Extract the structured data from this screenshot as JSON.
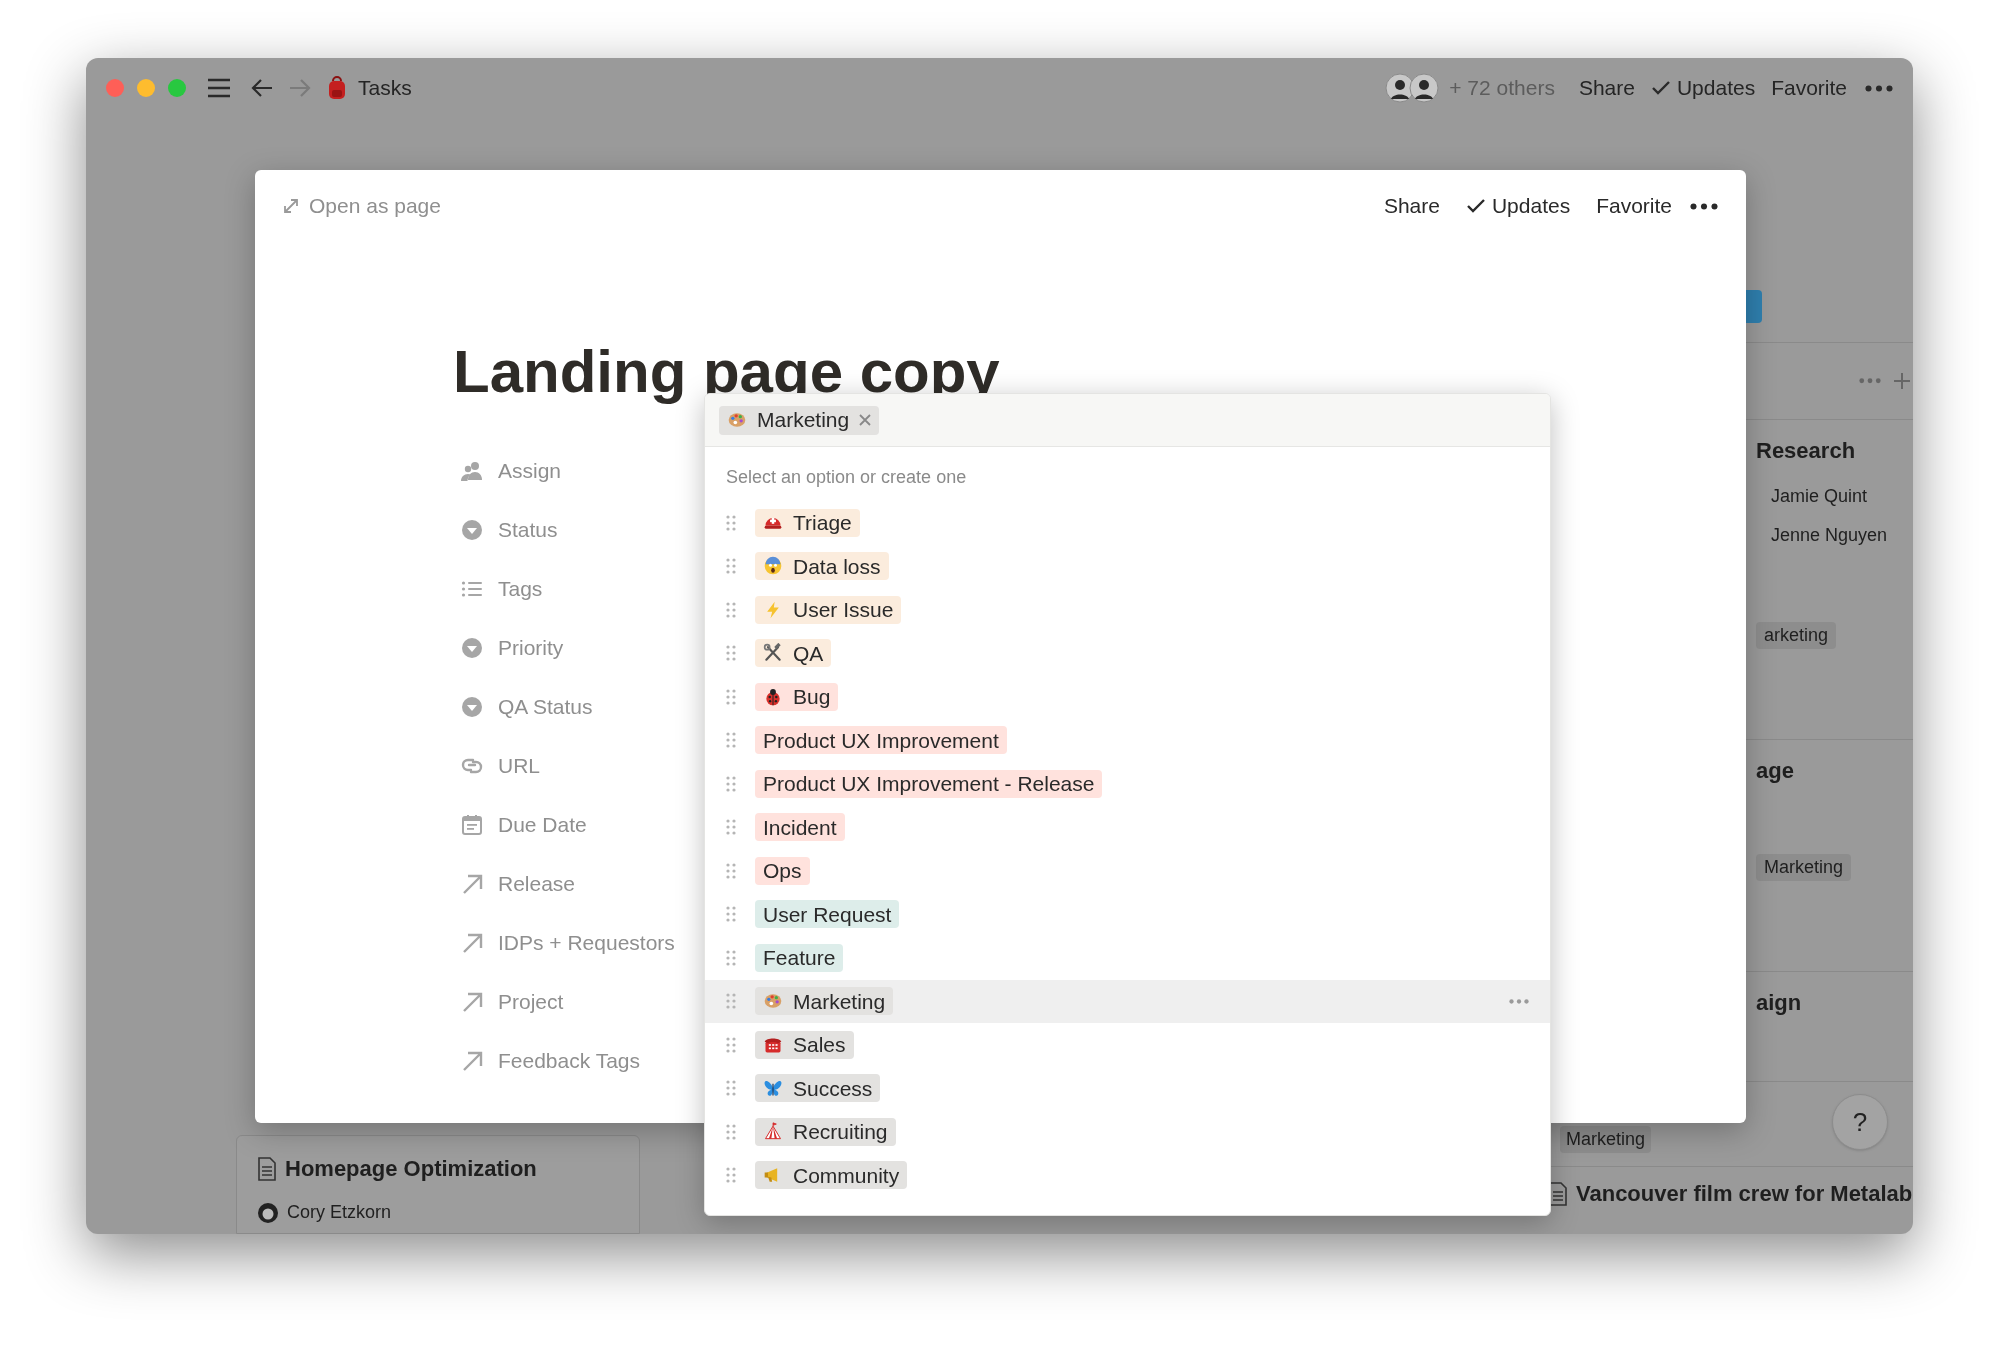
{
  "window": {
    "title": "Tasks",
    "nav": [
      {
        "kind": "back",
        "disabled": false
      },
      {
        "kind": "forward",
        "disabled": true
      }
    ],
    "collaborators": "+ 72 others",
    "actions": [
      {
        "label": "Share",
        "kind": "plain"
      },
      {
        "label": "Updates",
        "kind": "toggle"
      },
      {
        "label": "Favorite",
        "kind": "plain"
      }
    ]
  },
  "modal": {
    "open_as_page": "Open as page",
    "actions": [
      {
        "label": "Share",
        "kind": "plain"
      },
      {
        "label": "Updates",
        "kind": "toggle"
      },
      {
        "label": "Favorite",
        "kind": "plain"
      }
    ],
    "title": "Landing page copy",
    "properties": [
      {
        "kind": "people",
        "label": "Assign"
      },
      {
        "kind": "select",
        "label": "Status"
      },
      {
        "kind": "list",
        "label": "Tags"
      },
      {
        "kind": "select",
        "label": "Priority"
      },
      {
        "kind": "select",
        "label": "QA Status"
      },
      {
        "kind": "link",
        "label": "URL"
      },
      {
        "kind": "calendar",
        "label": "Due Date"
      },
      {
        "kind": "relation",
        "label": "Release"
      },
      {
        "kind": "relation",
        "label": "IDPs + Requestors"
      },
      {
        "kind": "relation",
        "label": "Project"
      },
      {
        "kind": "relation",
        "label": "Feedback Tags"
      }
    ]
  },
  "select_menu": {
    "selected_tags": [
      {
        "label": "Marketing",
        "kind": "palette",
        "color": "#e3e2e0"
      }
    ],
    "hint": "Select an option or create one",
    "options": [
      {
        "label": "Triage",
        "kind": "helmet",
        "color": "#fbecdd",
        "highlighted": false
      },
      {
        "label": "Data loss",
        "kind": "scream",
        "color": "#fbecdd",
        "highlighted": false
      },
      {
        "label": "User Issue",
        "kind": "bolt",
        "color": "#fbecdd",
        "highlighted": false
      },
      {
        "label": "QA",
        "kind": "tools",
        "color": "#fbecdd",
        "highlighted": false
      },
      {
        "label": "Bug",
        "kind": "ladybug",
        "color": "#ffe2dd",
        "highlighted": false
      },
      {
        "label": "Product UX Improvement",
        "color": "#ffe2dd",
        "highlighted": false
      },
      {
        "label": "Product UX Improvement - Release",
        "color": "#ffe2dd",
        "highlighted": false
      },
      {
        "label": "Incident",
        "color": "#ffe2dd",
        "highlighted": false
      },
      {
        "label": "Ops",
        "color": "#ffe2dd",
        "highlighted": false
      },
      {
        "label": "User Request",
        "color": "#ddedea",
        "highlighted": false
      },
      {
        "label": "Feature",
        "color": "#ddedea",
        "highlighted": false
      },
      {
        "label": "Marketing",
        "kind": "palette",
        "color": "#e3e2e0",
        "highlighted": true
      },
      {
        "label": "Sales",
        "kind": "phone",
        "color": "#e3e2e0",
        "highlighted": false
      },
      {
        "label": "Success",
        "kind": "butterfly",
        "color": "#e3e2e0",
        "highlighted": false
      },
      {
        "label": "Recruiting",
        "kind": "tent",
        "color": "#e3e2e0",
        "highlighted": false
      },
      {
        "label": "Community",
        "kind": "megaphone",
        "color": "#e3e2e0",
        "highlighted": false
      }
    ]
  },
  "board": {
    "left_cards": [
      {
        "title": "Homepage Optimization",
        "person": "Cory Etzkorn"
      }
    ],
    "right_cards": [
      {
        "title": "Research",
        "people": [
          "Jamie Quint",
          "Jenne Nguyen"
        ],
        "tag": "arketing"
      },
      {
        "title": "age",
        "tag": "Marketing"
      },
      {
        "title": "aign"
      }
    ],
    "bottom_tag": "Marketing",
    "bottom_item": "Vancouver film crew for Metalab"
  },
  "help": "?"
}
